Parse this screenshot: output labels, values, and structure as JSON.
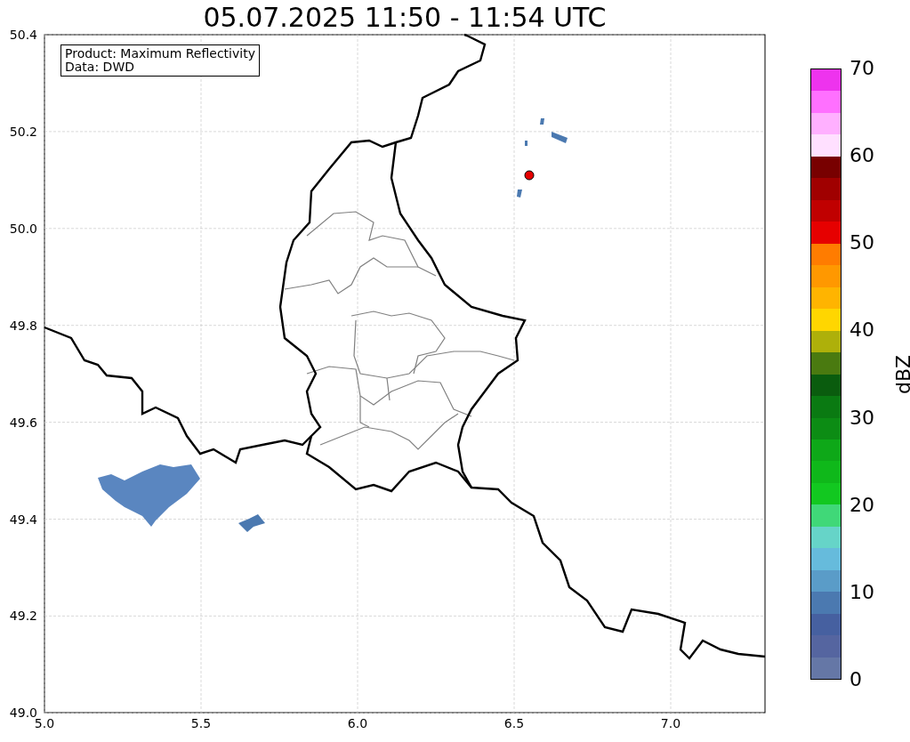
{
  "title": "05.07.2025 11:50 - 11:54 UTC",
  "info_box": {
    "lines": [
      "Product: Maximum Reflectivity",
      "Data: DWD"
    ]
  },
  "map": {
    "x_ticks": [
      "5.0",
      "5.5",
      "6.0",
      "6.5",
      "7.0"
    ],
    "y_ticks": [
      "50.4",
      "50.2",
      "50.0",
      "49.8",
      "49.6",
      "49.4",
      "49.2",
      "49.0"
    ]
  },
  "colorbar": {
    "label": "dBZ",
    "ticks": [
      "70",
      "60",
      "50",
      "40",
      "30",
      "20",
      "10",
      "0"
    ],
    "bins": [
      {
        "color": "#ee33ee"
      },
      {
        "color": "#ff70ff"
      },
      {
        "color": "#ffb0ff"
      },
      {
        "color": "#ffe0ff"
      },
      {
        "color": "#780000"
      },
      {
        "color": "#a00000"
      },
      {
        "color": "#c00000"
      },
      {
        "color": "#e60000"
      },
      {
        "color": "#ff7c00"
      },
      {
        "color": "#ff9800"
      },
      {
        "color": "#ffb400"
      },
      {
        "color": "#ffd600"
      },
      {
        "color": "#aeb00a"
      },
      {
        "color": "#4a7a10"
      },
      {
        "color": "#0a5c0e"
      },
      {
        "color": "#0a7a12"
      },
      {
        "color": "#0c8c14"
      },
      {
        "color": "#0ea818"
      },
      {
        "color": "#0fb81a"
      },
      {
        "color": "#12c820"
      },
      {
        "color": "#40d878"
      },
      {
        "color": "#66d4c8"
      },
      {
        "color": "#66bbdc"
      },
      {
        "color": "#5a9cc8"
      },
      {
        "color": "#4b79b0"
      },
      {
        "color": "#4660a0"
      },
      {
        "color": "#5565a0"
      },
      {
        "color": "#6577a6"
      }
    ]
  }
}
